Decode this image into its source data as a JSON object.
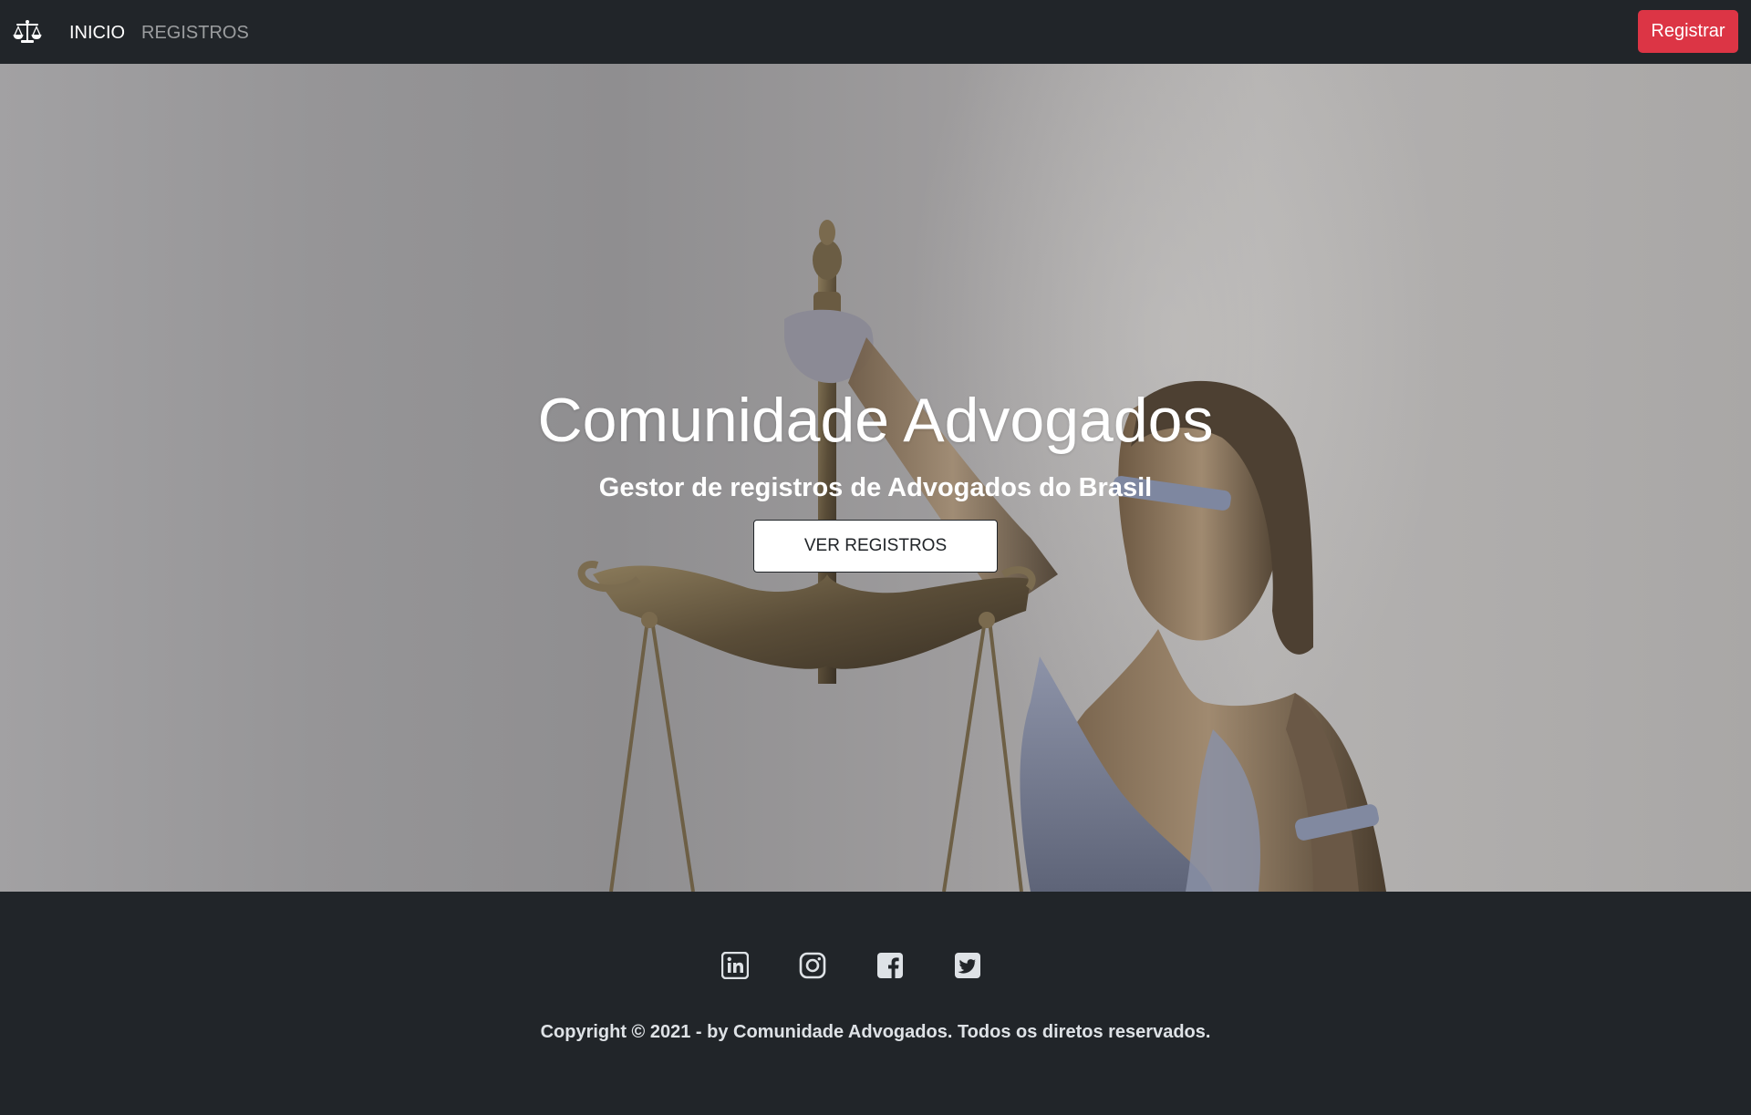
{
  "navbar": {
    "brand_icon": "scales-icon",
    "links": [
      {
        "label": "INICIO",
        "active": true
      },
      {
        "label": "REGISTROS",
        "active": false
      }
    ],
    "register_button": "Registrar"
  },
  "hero": {
    "title": "Comunidade Advogados",
    "subtitle": "Gestor de registros de Advogados do Brasil",
    "cta_label": "VER REGISTROS"
  },
  "footer": {
    "social_icons": [
      "linkedin-icon",
      "instagram-icon",
      "facebook-icon",
      "twitter-icon"
    ],
    "copyright": "Copyright © 2021 - by Comunidade Advogados. Todos os diretos reservados."
  },
  "colors": {
    "dark": "#212529",
    "danger": "#dc3545",
    "muted_link": "#8a8d90",
    "footer_text": "#dee2e6"
  }
}
